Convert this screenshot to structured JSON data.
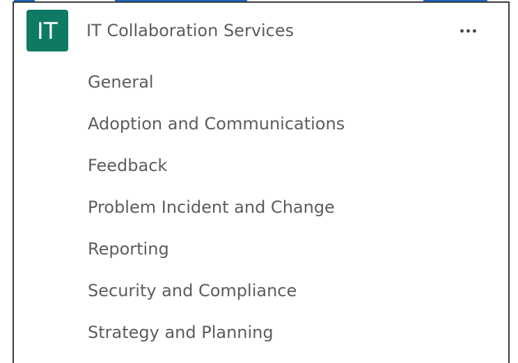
{
  "team": {
    "avatar_initials": "IT",
    "name": "IT Collaboration Services",
    "more_options_icon": "more-horizontal-icon",
    "avatar_color": "#0e7a64"
  },
  "channels": [
    {
      "label": "General"
    },
    {
      "label": "Adoption and Communications"
    },
    {
      "label": "Feedback"
    },
    {
      "label": "Problem Incident and Change"
    },
    {
      "label": "Reporting"
    },
    {
      "label": "Security and Compliance"
    },
    {
      "label": "Strategy and Planning"
    }
  ],
  "colors": {
    "text": "#5c5c5c",
    "border": "#3a3a3a",
    "highlight": "#1e64c8"
  }
}
